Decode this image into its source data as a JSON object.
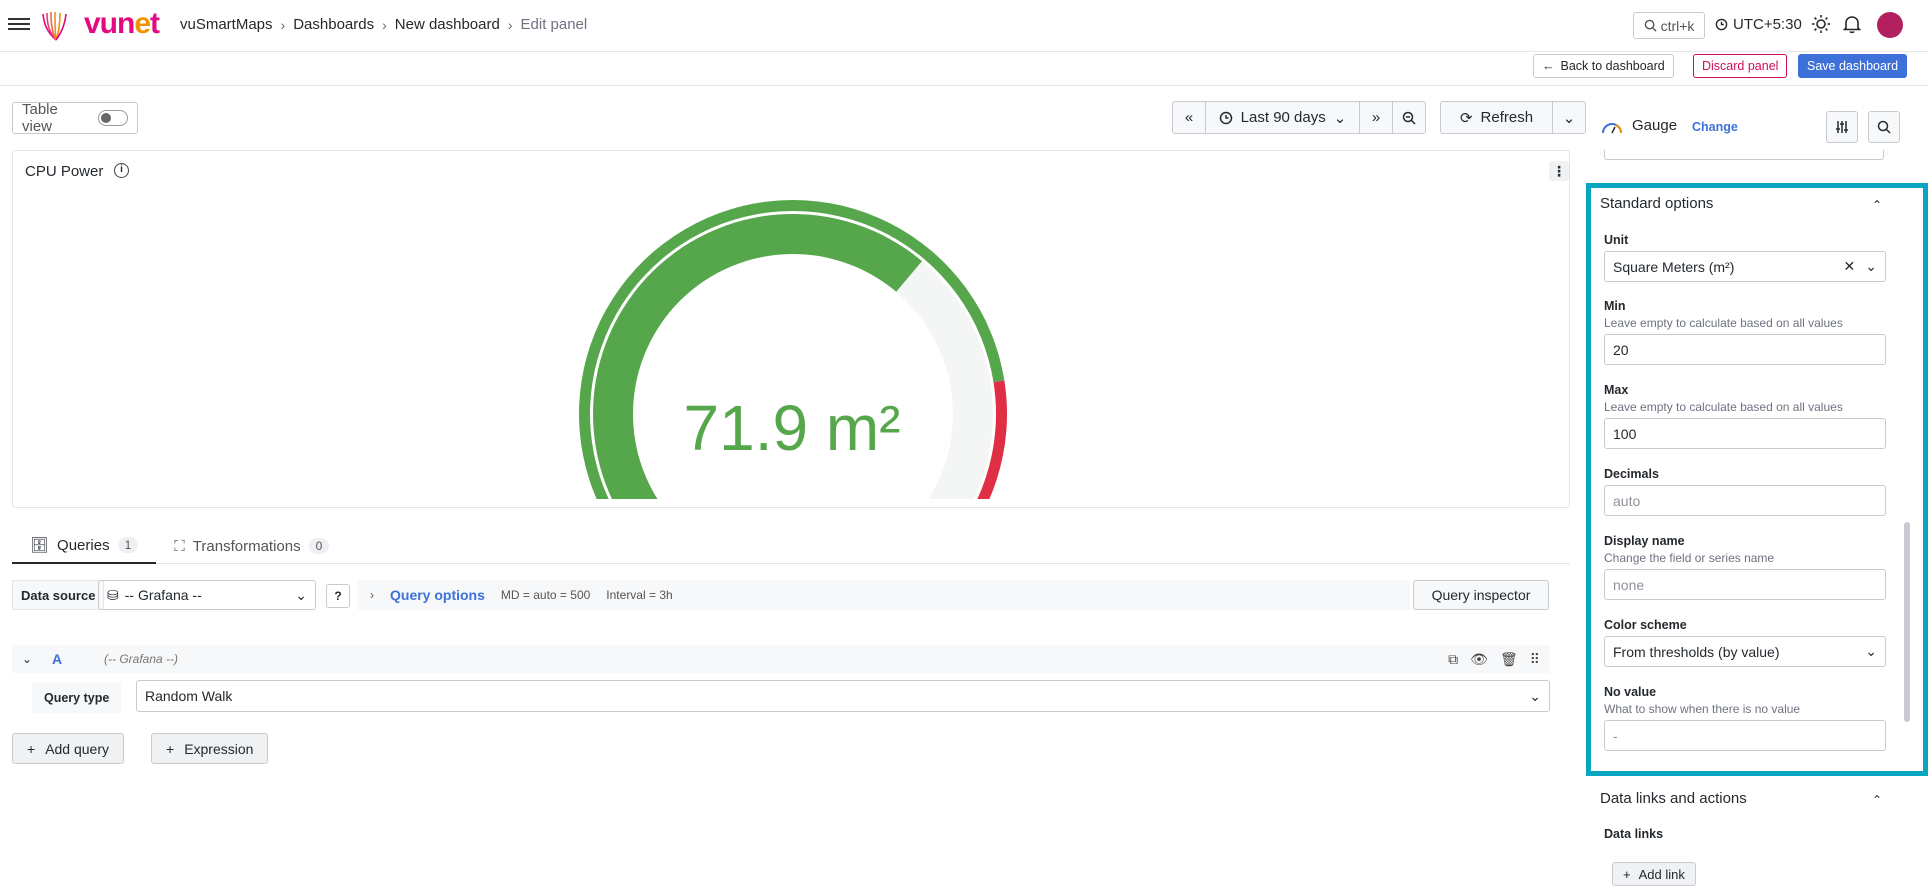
{
  "header": {
    "logo_text": "vunet",
    "breadcrumbs": [
      "vuSmartMaps",
      "Dashboards",
      "New dashboard",
      "Edit panel"
    ],
    "search_shortcut": "ctrl+k",
    "timezone": "UTC+5:30"
  },
  "actions": {
    "back": "Back to dashboard",
    "discard": "Discard panel",
    "save": "Save dashboard"
  },
  "viewbar": {
    "table_view": "Table view",
    "time_range": "Last 90 days",
    "refresh": "Refresh"
  },
  "panel": {
    "title": "CPU Power",
    "gauge_value": "71.9 m²",
    "gauge_min": 20,
    "gauge_max": 100,
    "gauge_current": 71.9,
    "gauge_color": "#56a64b",
    "threshold_color": "#e02f44"
  },
  "tabs": [
    {
      "label": "Queries",
      "count": "1"
    },
    {
      "label": "Transformations",
      "count": "0"
    }
  ],
  "query": {
    "data_source_label": "Data source",
    "data_source": "-- Grafana --",
    "options_label": "Query options",
    "md": "MD = auto = 500",
    "interval": "Interval = 3h",
    "inspector": "Query inspector",
    "ref": "A",
    "ref_ds": "(-- Grafana --)",
    "type_label": "Query type",
    "type_value": "Random Walk",
    "add_query": "Add query",
    "expression": "Expression"
  },
  "options_pane": {
    "viz": "Gauge",
    "change": "Change",
    "standard_title": "Standard options",
    "unit_label": "Unit",
    "unit_value": "Square Meters (m²)",
    "min_label": "Min",
    "min_desc": "Leave empty to calculate based on all values",
    "min_value": "20",
    "max_label": "Max",
    "max_desc": "Leave empty to calculate based on all values",
    "max_value": "100",
    "decimals_label": "Decimals",
    "decimals_placeholder": "auto",
    "display_label": "Display name",
    "display_desc": "Change the field or series name",
    "display_placeholder": "none",
    "color_label": "Color scheme",
    "color_value": "From thresholds (by value)",
    "novalue_label": "No value",
    "novalue_desc": "What to show when there is no value",
    "novalue_placeholder": "-",
    "links_title": "Data links and actions",
    "links_label": "Data links",
    "add_link": "Add link"
  }
}
